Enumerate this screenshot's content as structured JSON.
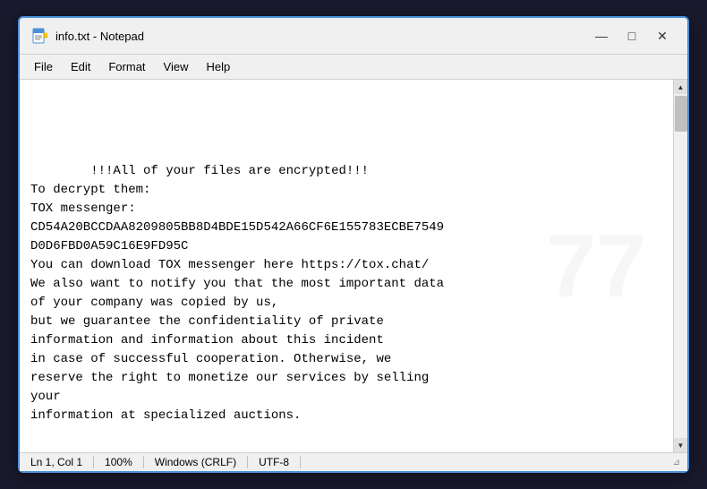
{
  "window": {
    "title": "info.txt - Notepad",
    "icon": "notepad-icon"
  },
  "titlebar": {
    "minimize_label": "—",
    "maximize_label": "□",
    "close_label": "✕"
  },
  "menubar": {
    "items": [
      {
        "label": "File",
        "id": "file"
      },
      {
        "label": "Edit",
        "id": "edit"
      },
      {
        "label": "Format",
        "id": "format"
      },
      {
        "label": "View",
        "id": "view"
      },
      {
        "label": "Help",
        "id": "help"
      }
    ]
  },
  "editor": {
    "content": "!!!All of your files are encrypted!!!\nTo decrypt them:\nTOX messenger:\nCD54A20BCCDAA8209805BB8D4BDE15D542A66CF6E155783ECBE7549\nD0D6FBD0A59C16E9FD95C\nYou can download TOX messenger here https://tox.chat/\nWe also want to notify you that the most important data\nof your company was copied by us,\nbut we guarantee the confidentiality of private\ninformation and information about this incident\nin case of successful cooperation. Otherwise, we\nreserve the right to monetize our services by selling\nyour\ninformation at specialized auctions."
  },
  "statusbar": {
    "position": "Ln 1, Col 1",
    "zoom": "100%",
    "line_ending": "Windows (CRLF)",
    "encoding": "UTF-8"
  }
}
